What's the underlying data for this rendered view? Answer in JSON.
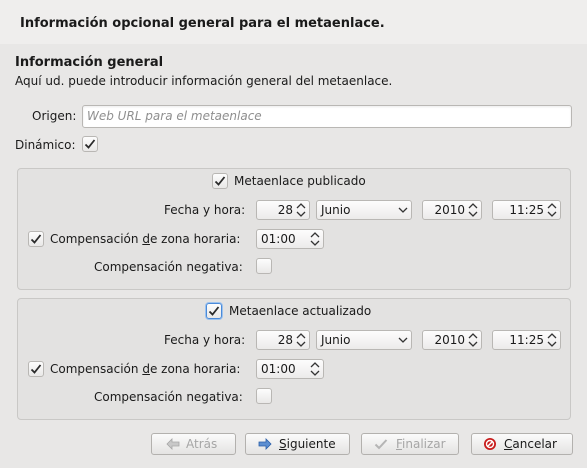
{
  "header": {
    "title": "Información opcional general para el metaenlace."
  },
  "section": {
    "title": "Información general",
    "description": "Aquí ud. puede introducir información general del metaenlace."
  },
  "origin": {
    "label": "Origen:",
    "placeholder": "Web URL para el metaenlace"
  },
  "dynamic": {
    "label": "Dinámico:",
    "checked": true
  },
  "published": {
    "checkbox_label": "Metaenlace publicado",
    "datetime_label": "Fecha y hora:",
    "day": "28",
    "month": "Junio",
    "year": "2010",
    "time": "11:25",
    "tz_label_pre": "Compensación ",
    "tz_label_u": "d",
    "tz_label_post": "e zona horaria:",
    "tz_value": "01:00",
    "negative_label": "Compensación negativa:"
  },
  "updated": {
    "checkbox_label": "Metaenlace actualizado",
    "datetime_label": "Fecha y hora:",
    "day": "28",
    "month": "Junio",
    "year": "2010",
    "time": "11:25",
    "tz_label_pre": "Compensación ",
    "tz_label_u": "d",
    "tz_label_post": "e zona horaria:",
    "tz_value": "01:00",
    "negative_label": "Compensación negativa:"
  },
  "buttons": {
    "back": "Atrás",
    "next_u": "S",
    "next_rest": "iguiente",
    "finish_u": "F",
    "finish_rest": "inalizar",
    "cancel_u": "C",
    "cancel_rest": "ancelar"
  },
  "icons": {
    "back": "arrow-left-icon",
    "next": "arrow-right-icon",
    "finish": "check-icon",
    "cancel": "cancel-icon"
  },
  "colors": {
    "check": "#2b2b2b",
    "focus": "#4a8ad9",
    "next_arrow": "#2a5ea8",
    "cancel_red": "#c81c1c"
  }
}
